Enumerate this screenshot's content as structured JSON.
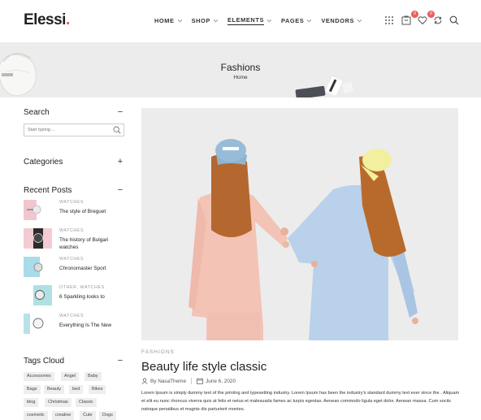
{
  "header": {
    "logo_text": "Elessi",
    "logo_dot": ".",
    "nav": [
      {
        "label": "HOME",
        "dropdown": true,
        "active": false
      },
      {
        "label": "SHOP",
        "dropdown": true,
        "active": false
      },
      {
        "label": "ELEMENTS",
        "dropdown": true,
        "active": true
      },
      {
        "label": "PAGES",
        "dropdown": true,
        "active": false
      },
      {
        "label": "VENDORS",
        "dropdown": true,
        "active": false
      }
    ],
    "icons": [
      "grid-icon",
      "compare-icon",
      "wishlist-icon",
      "refresh-icon",
      "search-icon"
    ],
    "compare_count": "0",
    "wishlist_count": "0"
  },
  "banner": {
    "title": "Fashions",
    "breadcrumb": "Home"
  },
  "sidebar": {
    "search": {
      "title": "Search",
      "toggle": "−",
      "placeholder": "Start typing ..."
    },
    "categories": {
      "title": "Categories",
      "toggle": "+"
    },
    "recent_posts": {
      "title": "Recent Posts",
      "toggle": "−",
      "items": [
        {
          "category": "WATCHES",
          "title": "The style of Breguet"
        },
        {
          "category": "WATCHES",
          "title": "The history of Bulgari watches"
        },
        {
          "category": "WATCHES",
          "title": "Chronomaster Sport"
        },
        {
          "category": "OTHER, WATCHES",
          "title": "6 Sparkling looks to"
        },
        {
          "category": "WATCHES",
          "title": "Everything Is The New"
        }
      ]
    },
    "tags_cloud": {
      "title": "Tags Cloud",
      "toggle": "−",
      "tags": [
        "Accessories",
        "Angel",
        "Baby",
        "Bags",
        "Beauty",
        "bed",
        "Bikes",
        "blog",
        "Christmas",
        "Classic",
        "cosmetic",
        "creative",
        "Cute",
        "Dogs"
      ]
    }
  },
  "post": {
    "category": "FASHIONS",
    "title": "Beauty life style classic",
    "author": "By NasaTheme",
    "date": "June 6, 2020",
    "excerpt": "Lorem Ipsum is simply dummy text of the printing and typesetting industry. Lorem Ipsum has been the industry's standard dummy text ever since the . Aliquam et elit eu nunc rhoncus viverra quis at felis et netus et malesuada fames ac turpis egestas. Aenean commodo ligula eget dolor. Aenean massa. Cum sociis natoque penatibus et magnis dis parturient montes."
  },
  "colors": {
    "accent": "#e05656",
    "badge": "#ec5b5b",
    "banner_bg": "#ececec",
    "hero_bg": "#ebebeb"
  }
}
